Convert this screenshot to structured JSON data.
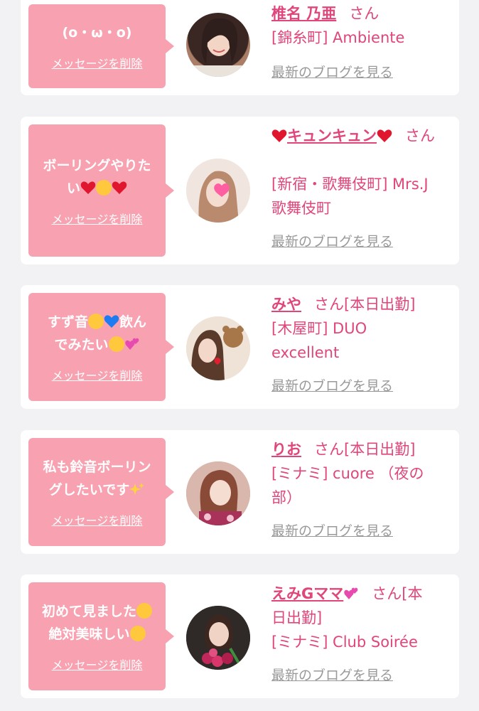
{
  "delete_label": "メッセージを削除",
  "blog_label": "最新のブログを見る",
  "san_suffix": "さん",
  "cards": [
    {
      "message": "(o・ω・o)",
      "name": "椎名 乃亜",
      "status": "",
      "shop": "[錦糸町] Ambiente"
    },
    {
      "message_line1": "ボーリングやりた",
      "message_line2": "い",
      "name": "キュンキュン",
      "status": "",
      "shop_line1": "[新宿・歌舞伎町] Mrs.J",
      "shop_line2": "歌舞伎町"
    },
    {
      "message_line1a": "すず音",
      "message_line1b": "飲ん",
      "message_line2": "でみたい",
      "name": "みや",
      "status": "[本日出勤]",
      "shop_line1": "[木屋町] DUO",
      "shop_line2": "excellent"
    },
    {
      "message_line1": "私も鈴音ボーリン",
      "message_line2": "グしたいです",
      "name": "りお",
      "status": "[本日出勤]",
      "shop_line1": "[ミナミ] cuore （夜の",
      "shop_line2": "部）"
    },
    {
      "message_line1": "初めて見ました",
      "message_line2": "絶対美味しい",
      "name": "えみGママ",
      "status_line1": "[本",
      "status_line2": "日出勤]",
      "shop": "[ミナミ] Club Soirée"
    }
  ]
}
